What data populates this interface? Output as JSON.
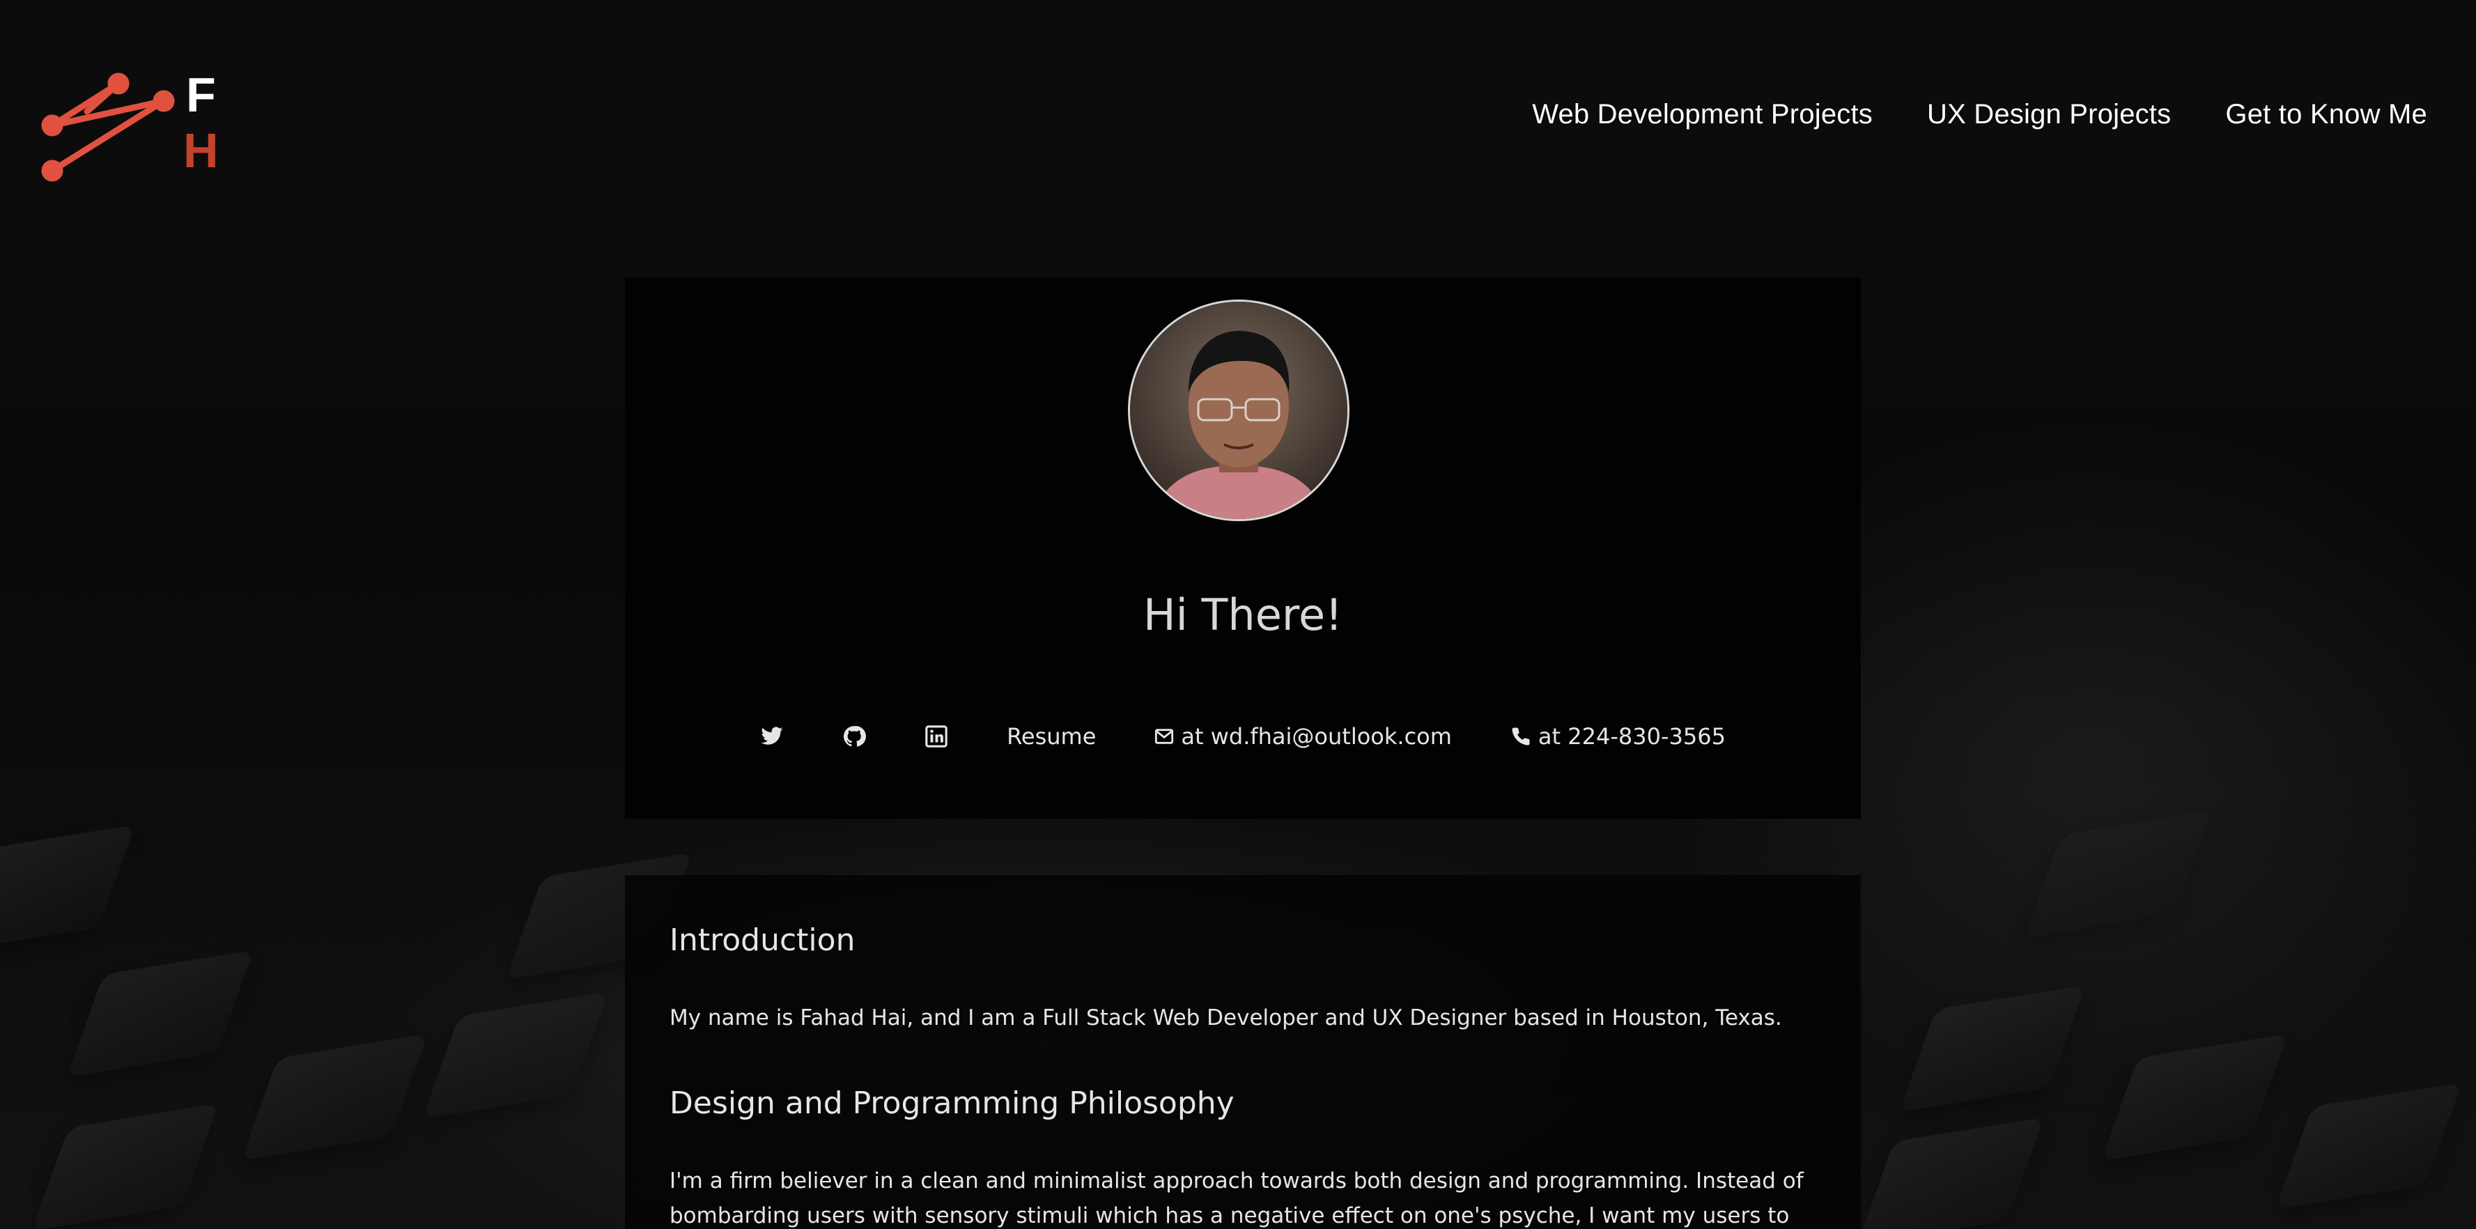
{
  "logo": {
    "letter_top": "F",
    "letter_bottom": "H",
    "accent": "#e0523f",
    "accent_dark": "#c2432a"
  },
  "nav": {
    "items": [
      {
        "label": "Web Development Projects"
      },
      {
        "label": "UX Design Projects"
      },
      {
        "label": "Get to Know Me"
      }
    ]
  },
  "hero": {
    "title": "Hi There!",
    "links": {
      "twitter_icon": "twitter-icon",
      "github_icon": "github-icon",
      "linkedin_icon": "linkedin-icon",
      "resume_label": "Resume",
      "email_label": "at wd.fhai@outlook.com",
      "phone_label": "at 224-830-3565"
    }
  },
  "intro": {
    "heading": "Introduction",
    "text": "My name is Fahad Hai, and I am a Full Stack Web Developer and UX Designer based in Houston, Texas.",
    "philosophy_heading": "Design and Programming Philosophy",
    "philosophy_text": "I'm a firm believer in a clean and minimalist approach towards both design and programming. Instead of bombarding users with sensory stimuli which has a negative effect on one's psyche, I want my users to feel calm"
  }
}
